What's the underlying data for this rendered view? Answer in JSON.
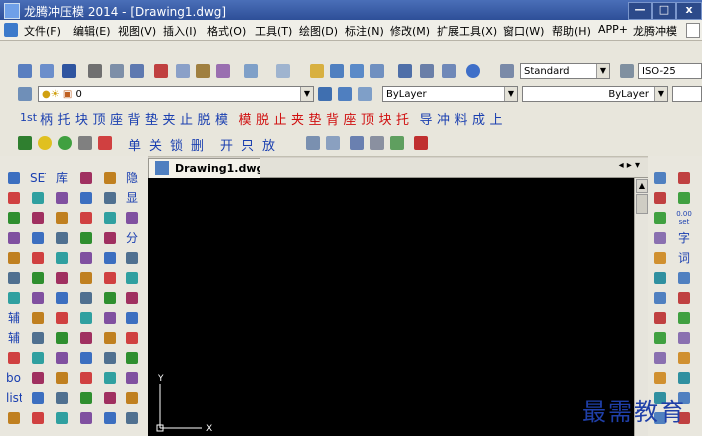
{
  "window": {
    "title": "龙腾冲压模 2014 - [Drawing1.dwg]",
    "min_label": "—",
    "max_label": "□",
    "close_label": "x"
  },
  "menu": {
    "items": [
      "文件(F)",
      "编辑(E)",
      "视图(V)",
      "插入(I)",
      "格式(O)",
      "工具(T)",
      "绘图(D)",
      "标注(N)",
      "修改(M)",
      "扩展工具(X)",
      "窗口(W)",
      "帮助(H)",
      "APP+",
      "龙腾冲模"
    ]
  },
  "toolbar_standard": {
    "text_style": "Standard",
    "dim_style": "ISO-25"
  },
  "layers": {
    "current_layer": "0",
    "color": "ByLayer",
    "linetype": "ByLayer"
  },
  "mold_toolbar": {
    "lead": "1st",
    "items": [
      "柄",
      "托",
      "块",
      "顶",
      "座",
      "背",
      "垫",
      "夹",
      "止",
      "脱",
      "模",
      "模",
      "脱",
      "止",
      "夹",
      "垫",
      "背",
      "座",
      "顶",
      "块",
      "托",
      "导",
      "冲",
      "料",
      "成",
      "上"
    ]
  },
  "toolbar_row4": {
    "items": [
      "单",
      "关",
      "锁",
      "删",
      "开",
      "只",
      "放"
    ]
  },
  "left_palette": {
    "col2": [
      "SET"
    ],
    "col3": [
      "库"
    ],
    "col6": [
      "隐",
      "显",
      "分"
    ],
    "col1_text": [
      "辅",
      "辅",
      "bom",
      "list"
    ]
  },
  "right_palette": {
    "col2": [
      "字",
      "词"
    ],
    "label_set": "0.00 set"
  },
  "document_tab": {
    "label": "Drawing1.dwg",
    "nav": "◂ ▸ ▾"
  },
  "ucs": {
    "y_label": "Y",
    "x_label": "X"
  },
  "watermark": "最需教育",
  "colors": {
    "title_bar": "#2e4f98",
    "canvas": "#000000",
    "mold_red": "#d01010",
    "mold_blue": "#1a3fb0",
    "watermark": "#1f3fa8"
  }
}
